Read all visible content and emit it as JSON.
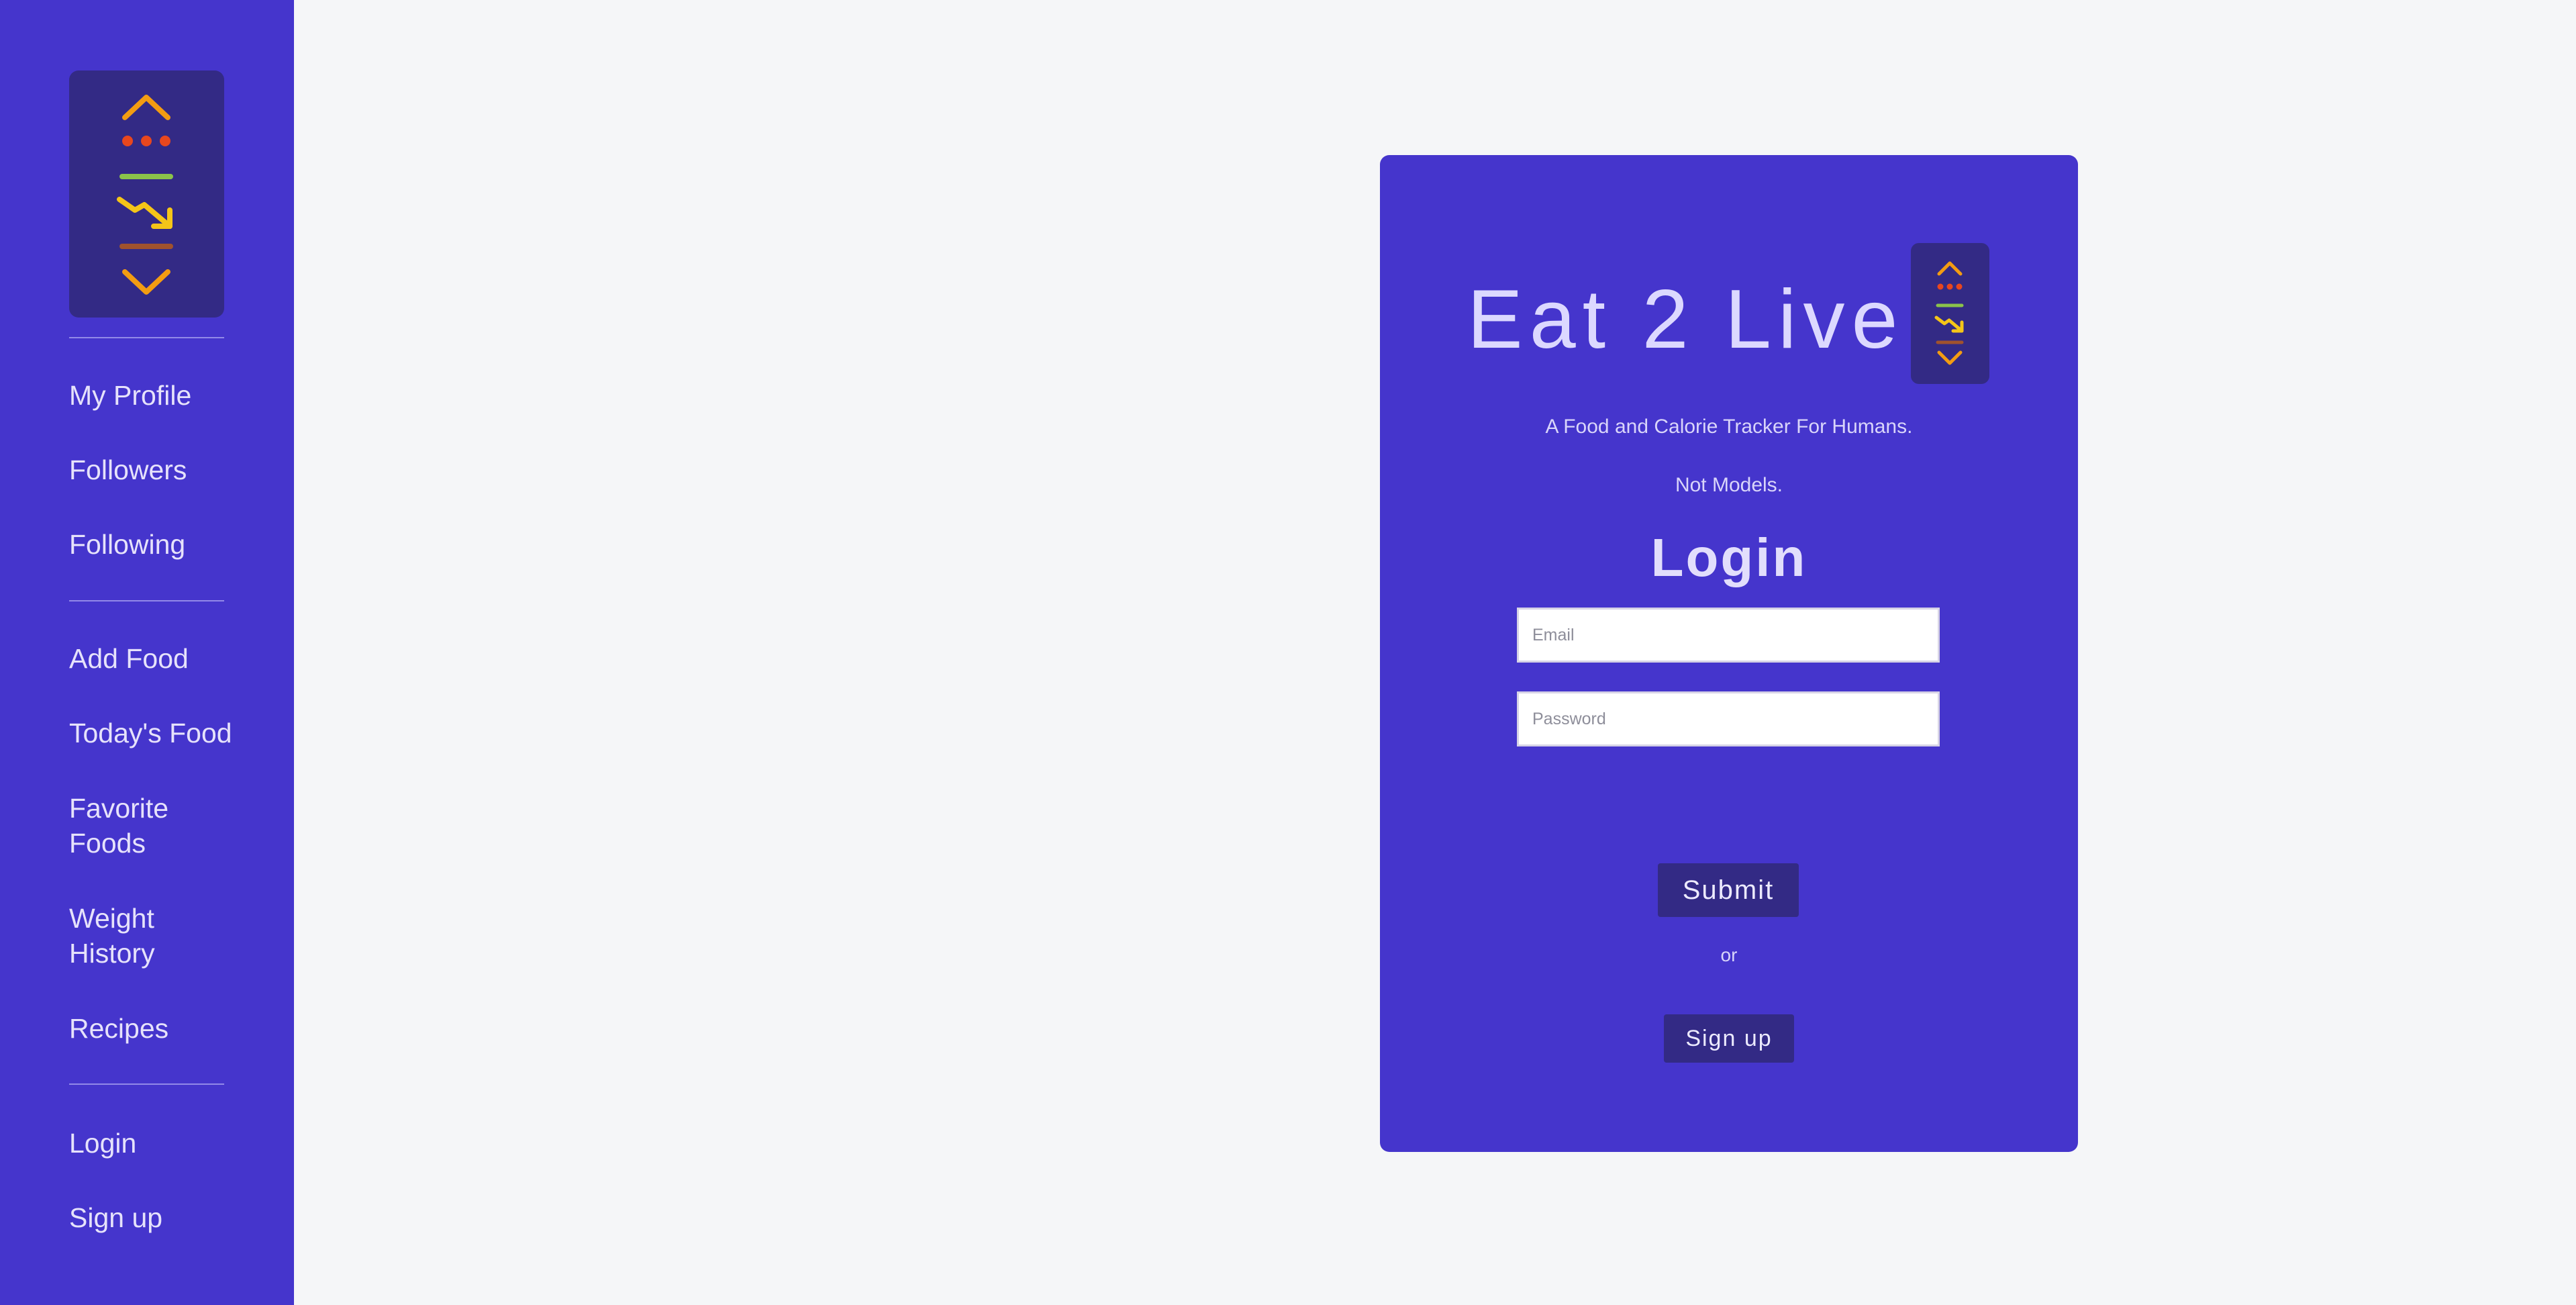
{
  "sidebar": {
    "logo_icon": "app-logo-icon",
    "profile_items": [
      {
        "label": "My Profile"
      },
      {
        "label": "Followers"
      },
      {
        "label": "Following"
      }
    ],
    "food_items": [
      {
        "label": "Add Food"
      },
      {
        "label": "Today's Food"
      },
      {
        "label": "Favorite Foods"
      },
      {
        "label": "Weight History"
      },
      {
        "label": "Recipes"
      }
    ],
    "auth_items": [
      {
        "label": "Login"
      },
      {
        "label": "Sign up"
      }
    ]
  },
  "card": {
    "title": "Eat 2 Live",
    "logo_icon": "app-logo-icon",
    "tagline_line1": "A Food and Calorie Tracker For Humans.",
    "tagline_line2": "Not Models.",
    "heading": "Login",
    "email_placeholder": "Email",
    "email_value": "",
    "password_placeholder": "Password",
    "password_value": "",
    "submit_label": "Submit",
    "or_text": "or",
    "signup_label": "Sign up"
  },
  "colors": {
    "brand": "#4535cc",
    "brand_dark": "#332a85",
    "page_bg": "#f5f6f8",
    "logo_orange": "#f39c12",
    "logo_red": "#e8471e",
    "logo_green": "#8bc34a",
    "logo_yellow": "#f5c518",
    "logo_brown": "#a0522d"
  }
}
